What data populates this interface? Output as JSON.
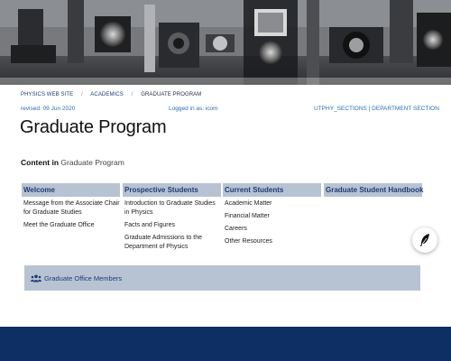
{
  "breadcrumb": {
    "items": [
      "PHYSICS WEB SITE",
      "ACADEMICS",
      "GRADUATE PROGRAM"
    ],
    "separator": "/"
  },
  "meta": {
    "revised": "revised: 09 Jun 2020",
    "logged_in": "Logged in as: icom",
    "sections": "UTPHY_SECTIONS | DEPARTMENT SECTION"
  },
  "page_title": "Graduate Program",
  "content_in": {
    "label": "Content in",
    "value": "Graduate Program"
  },
  "columns": [
    {
      "heading": "Welcome",
      "items": [
        "Message from the Associate Chair for Graduate Studies",
        "Meet the Graduate Office"
      ]
    },
    {
      "heading": "Prospective Students",
      "items": [
        "Introduction to Graduate Studies in Physics",
        "Facts and Figures",
        "Graduate Admissions to the Department of Physics"
      ]
    },
    {
      "heading": "Current Students",
      "items": [
        "Academic Matter",
        "Financial Matter",
        "Careers",
        "Other Resources"
      ]
    },
    {
      "heading": "Graduate Student Handbook",
      "items": []
    }
  ],
  "members_panel": {
    "label": "Graduate Office Members",
    "icon": "users-icon"
  },
  "feather_button": {
    "icon": "feather-icon"
  },
  "colors": {
    "heading_bg": "#b7c3d3",
    "link": "#1f3b73",
    "meta_link": "#2a6fb0",
    "footer": "#0e2f63"
  }
}
